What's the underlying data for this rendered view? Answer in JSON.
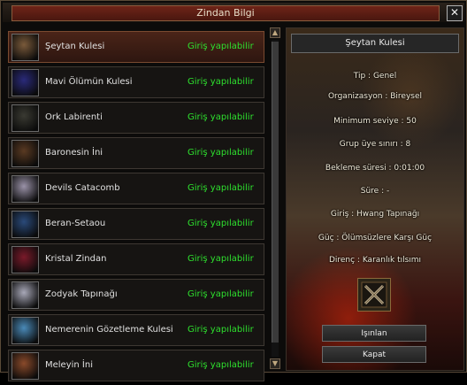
{
  "window": {
    "title": "Zindan Bilgi",
    "close": "✕"
  },
  "dungeons": [
    {
      "name": "Şeytan Kulesi",
      "status": "Giriş yapılabilir",
      "icon": "demon-tower-icon",
      "color": "#7a5a3a",
      "selected": true
    },
    {
      "name": "Mavi Ölümün Kulesi",
      "status": "Giriş yapılabilir",
      "icon": "blue-death-icon",
      "color": "#2a2a7a",
      "selected": false
    },
    {
      "name": "Ork Labirenti",
      "status": "Giriş yapılabilir",
      "icon": "orc-icon",
      "color": "#3a3a32",
      "selected": false
    },
    {
      "name": "Baronesin İni",
      "status": "Giriş yapılabilir",
      "icon": "spider-icon",
      "color": "#5a3a22",
      "selected": false
    },
    {
      "name": "Devils Catacomb",
      "status": "Giriş yapılabilir",
      "icon": "devil-icon",
      "color": "#9a92a8",
      "selected": false
    },
    {
      "name": "Beran-Setaou",
      "status": "Giriş yapılabilir",
      "icon": "dragon-icon",
      "color": "#2a4a7a",
      "selected": false
    },
    {
      "name": "Kristal Zindan",
      "status": "Giriş yapılabilir",
      "icon": "crystal-icon",
      "color": "#7a1a2a",
      "selected": false
    },
    {
      "name": "Zodyak Tapınağı",
      "status": "Giriş yapılabilir",
      "icon": "zodiac-icon",
      "color": "#a8a8b8",
      "selected": false
    },
    {
      "name": "Nemerenin Gözetleme Kulesi",
      "status": "Giriş yapılabilir",
      "icon": "ice-beast-icon",
      "color": "#4a8ab8",
      "selected": false
    },
    {
      "name": "Meleyin İni",
      "status": "Giriş yapılabilir",
      "icon": "meley-icon",
      "color": "#8a4a2a",
      "selected": false
    }
  ],
  "scroll": {
    "up": "▲",
    "down": "▼"
  },
  "detail": {
    "title": "Şeytan Kulesi",
    "type": "Tip : Genel",
    "organization": "Organizasyon : Bireysel",
    "min_level": "Minimum seviye : 50",
    "group_limit": "Grup üye sınırı : 8",
    "cooldown": "Bekleme süresi : 0:01:00",
    "duration": "Süre :  -",
    "entry": "Giriş : Hwang Tapınağı",
    "power": "Güç : Ölümsüzlere Karşı Güç",
    "resistance": "Direnç : Karanlık tılsımı",
    "teleport": "Işınlan",
    "close": "Kapat"
  },
  "colors": {
    "status_green": "#2ee02e",
    "title_red": "#6e2418"
  }
}
